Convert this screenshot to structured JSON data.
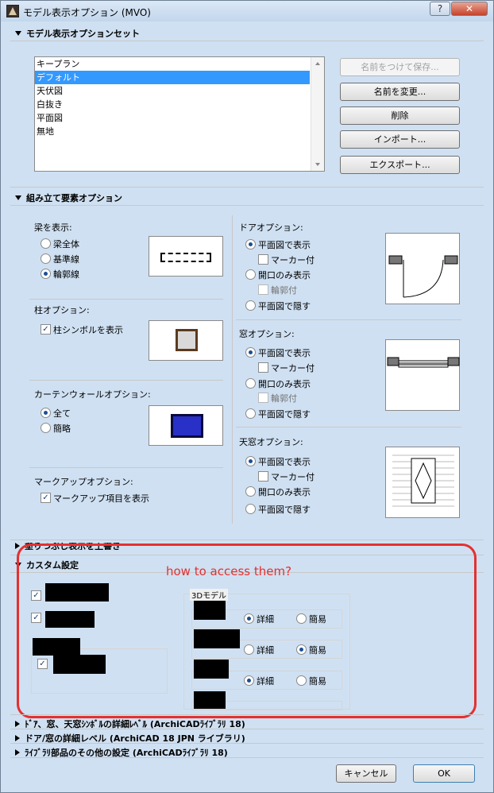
{
  "window": {
    "title": "モデル表示オプション (MVO)",
    "help_label": "?",
    "close_label": "✕"
  },
  "set_section": {
    "header": "モデル表示オプションセット",
    "items": [
      "キープラン",
      "デフォルト",
      "天伏図",
      "白抜き",
      "平面図",
      "無地"
    ],
    "selected_index": 1,
    "buttons": {
      "save_as": "名前をつけて保存...",
      "rename": "名前を変更...",
      "delete": "削除",
      "import": "インポート...",
      "export": "エクスポート..."
    }
  },
  "construction": {
    "header": "組み立て要素オプション",
    "beam": {
      "title": "梁を表示:",
      "options": [
        "梁全体",
        "基準線",
        "輪郭線"
      ],
      "selected": 2
    },
    "column": {
      "title": "柱オプション:",
      "show_symbol": "柱シンボルを表示"
    },
    "curtain": {
      "title": "カーテンウォールオプション:",
      "options": [
        "全て",
        "簡略"
      ],
      "selected": 0
    },
    "markup": {
      "title": "マークアップオプション:",
      "show_items": "マークアップ項目を表示"
    },
    "door": {
      "title": "ドアオプション:",
      "opt_show": "平面図で表示",
      "marker": "マーカー付",
      "opt_opening": "開口のみ表示",
      "outline": "輪郭付",
      "opt_hide": "平面図で隠す"
    },
    "window": {
      "title": "窓オプション:",
      "opt_show": "平面図で表示",
      "marker": "マーカー付",
      "opt_opening": "開口のみ表示",
      "outline": "輪郭付",
      "opt_hide": "平面図で隠す"
    },
    "skylight": {
      "title": "天窓オプション:",
      "opt_show": "平面図で表示",
      "marker": "マーカー付",
      "opt_opening": "開口のみ表示",
      "opt_hide": "平面図で隠す"
    }
  },
  "fill_section": {
    "header": "塗りつぶし表示を上書き"
  },
  "custom": {
    "header": "カスタム設定",
    "group_3d": "3Dモデル",
    "detail": "詳細",
    "simple": "簡易",
    "annotation": "how to access them?",
    "rows": [
      {
        "detail_selected": true
      },
      {
        "detail_selected": false
      },
      {
        "detail_selected": true
      }
    ]
  },
  "bottom_sections": [
    "ﾄﾞｱ、窓、天窓ｼﾝﾎﾞﾙの詳細ﾚﾍﾞﾙ (ArchiCADﾗｲﾌﾞﾗﾘ 18)",
    "ドア/窓の詳細レベル (ArchiCAD 18 JPN ライブラリ)",
    "ﾗｲﾌﾞﾗﾘ部品のその他の設定 (ArchiCADﾗｲﾌﾞﾗﾘ 18)"
  ],
  "footer": {
    "cancel": "キャンセル",
    "ok": "OK"
  },
  "colors": {
    "accent": "#3399ff",
    "annotation": "#e53030",
    "radio_dot": "#1c4e94"
  }
}
